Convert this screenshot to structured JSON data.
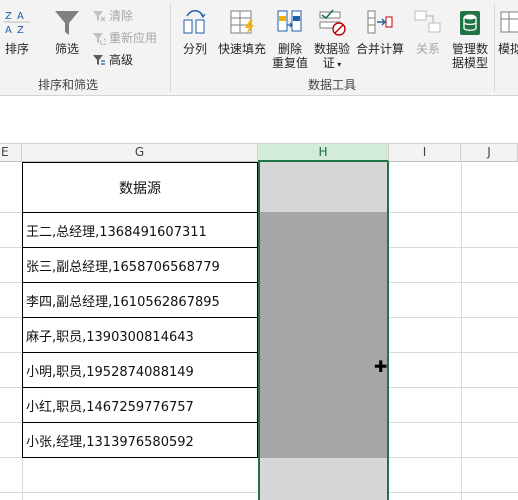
{
  "ribbon": {
    "sort_label": "排序",
    "filter_label": "筛选",
    "clear_label": "清除",
    "reapply_label": "重新应用",
    "advanced_label": "高级",
    "sort_filter_group": "排序和筛选",
    "text_to_columns_label": "分列",
    "flash_fill_label": "快速填充",
    "remove_duplicates_label_1": "删除",
    "remove_duplicates_label_2": "重复值",
    "data_validation_label_1": "数据验",
    "data_validation_label_2": "证",
    "consolidate_label": "合并计算",
    "relationships_label": "关系",
    "manage_model_label_1": "管理数",
    "manage_model_label_2": "据模型",
    "whatif_label": "模拟",
    "data_tools_group": "数据工具"
  },
  "columns": {
    "e": "E",
    "g": "G",
    "h": "H",
    "i": "I",
    "j": "J"
  },
  "table": {
    "header": "数据源",
    "rows": [
      "王二,总经理,1368491607311",
      "张三,副总经理,1658706568779",
      "李四,副总经理,1610562867895",
      "麻子,职员,1390300814643",
      "小明,职员,1952874088149",
      "小红,职员,1467259776757",
      "小张,经理,1313976580592"
    ]
  },
  "colors": {
    "accent": "#217346",
    "selection_light": "#d6d6d6",
    "selection_dark": "#a6a6a6"
  }
}
